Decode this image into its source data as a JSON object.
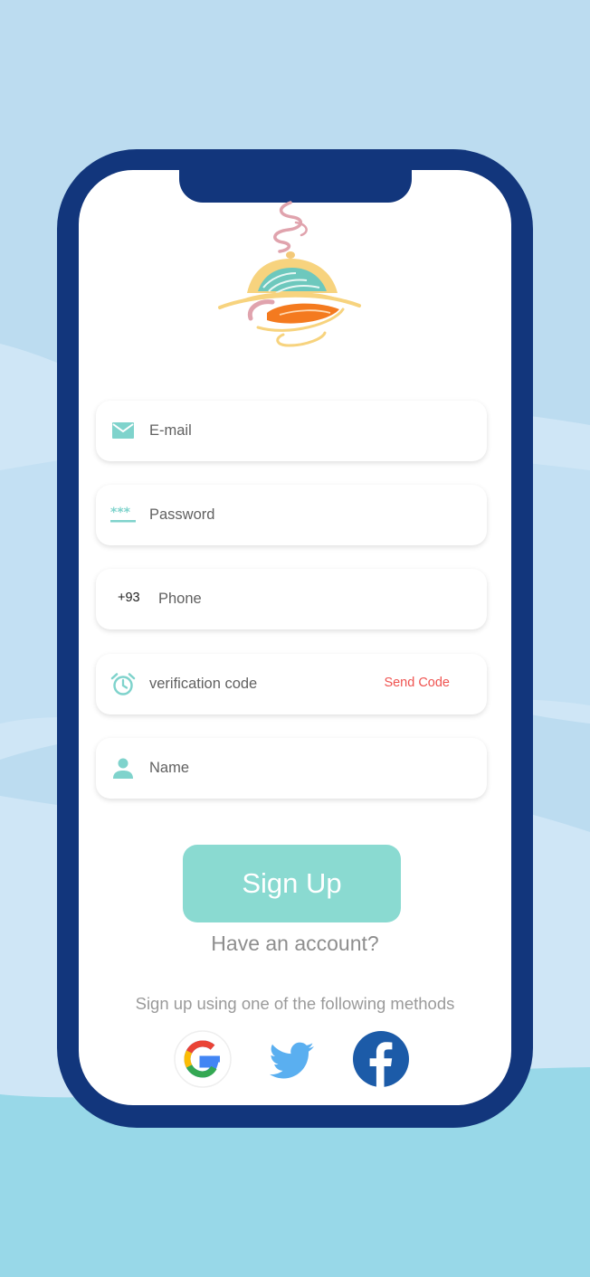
{
  "form": {
    "email": {
      "placeholder": "E-mail",
      "icon": "mail-icon"
    },
    "password": {
      "placeholder": "Password",
      "icon": "password-dots-icon"
    },
    "phone": {
      "prefix": "+93",
      "placeholder": "Phone"
    },
    "verification": {
      "placeholder": "verification code",
      "icon": "alarm-clock-icon",
      "send_label": "Send Code"
    },
    "name": {
      "placeholder": "Name",
      "icon": "person-icon"
    }
  },
  "actions": {
    "signup_label": "Sign Up",
    "have_account": "Have an account?"
  },
  "social": {
    "heading": "Sign up using one of the following methods",
    "providers": [
      "google",
      "twitter",
      "facebook"
    ]
  },
  "colors": {
    "accent": "#8adad1",
    "icon": "#7fd3cc",
    "frame": "#12367c",
    "send_code": "#ef5350",
    "background": "#bcdcf0"
  }
}
